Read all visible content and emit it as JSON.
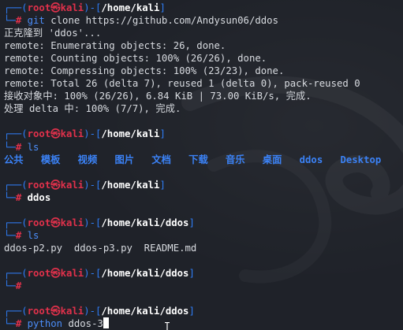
{
  "prompt": {
    "open_left": "┌──(",
    "user": "root",
    "at_symbol": "㉿",
    "host": "kali",
    "mid": ")-[",
    "close": "]",
    "bottom": "└─",
    "hash": "#"
  },
  "blocks": [
    {
      "path": "/home/kali",
      "command_keyword": "git",
      "command_rest": " clone https://github.com/Andysun06/ddos",
      "output": [
        "正克隆到 'ddos'...",
        "remote: Enumerating objects: 26, done.",
        "remote: Counting objects: 100% (26/26), done.",
        "remote: Compressing objects: 100% (23/23), done.",
        "remote: Total 26 (delta 7), reused 1 (delta 0), pack-reused 0",
        "接收对象中: 100% (26/26), 6.84 KiB | 73.00 KiB/s, 完成.",
        "处理 delta 中: 100% (7/7), 完成."
      ]
    },
    {
      "path": "/home/kali",
      "command_keyword": "ls",
      "command_rest": "",
      "ls_items": [
        "公共",
        "模板",
        "视频",
        "图片",
        "文档",
        "下载",
        "音乐",
        "桌面",
        "ddos",
        "Desktop"
      ]
    },
    {
      "path": "/home/kali",
      "command_plain": "ddos"
    },
    {
      "path": "/home/kali/ddos",
      "command_keyword": "ls",
      "command_rest": "",
      "output": [
        "ddos-p2.py  ddos-p3.py  README.md"
      ]
    },
    {
      "path": "/home/kali/ddos",
      "command_plain": ""
    },
    {
      "path": "/home/kali/ddos",
      "command_keyword": "python",
      "command_rest": " ddos-3"
    }
  ],
  "colors": {
    "frame": "#2f7df6",
    "user": "#e0314b",
    "path": "#ffffff",
    "background": "#1f2229"
  }
}
